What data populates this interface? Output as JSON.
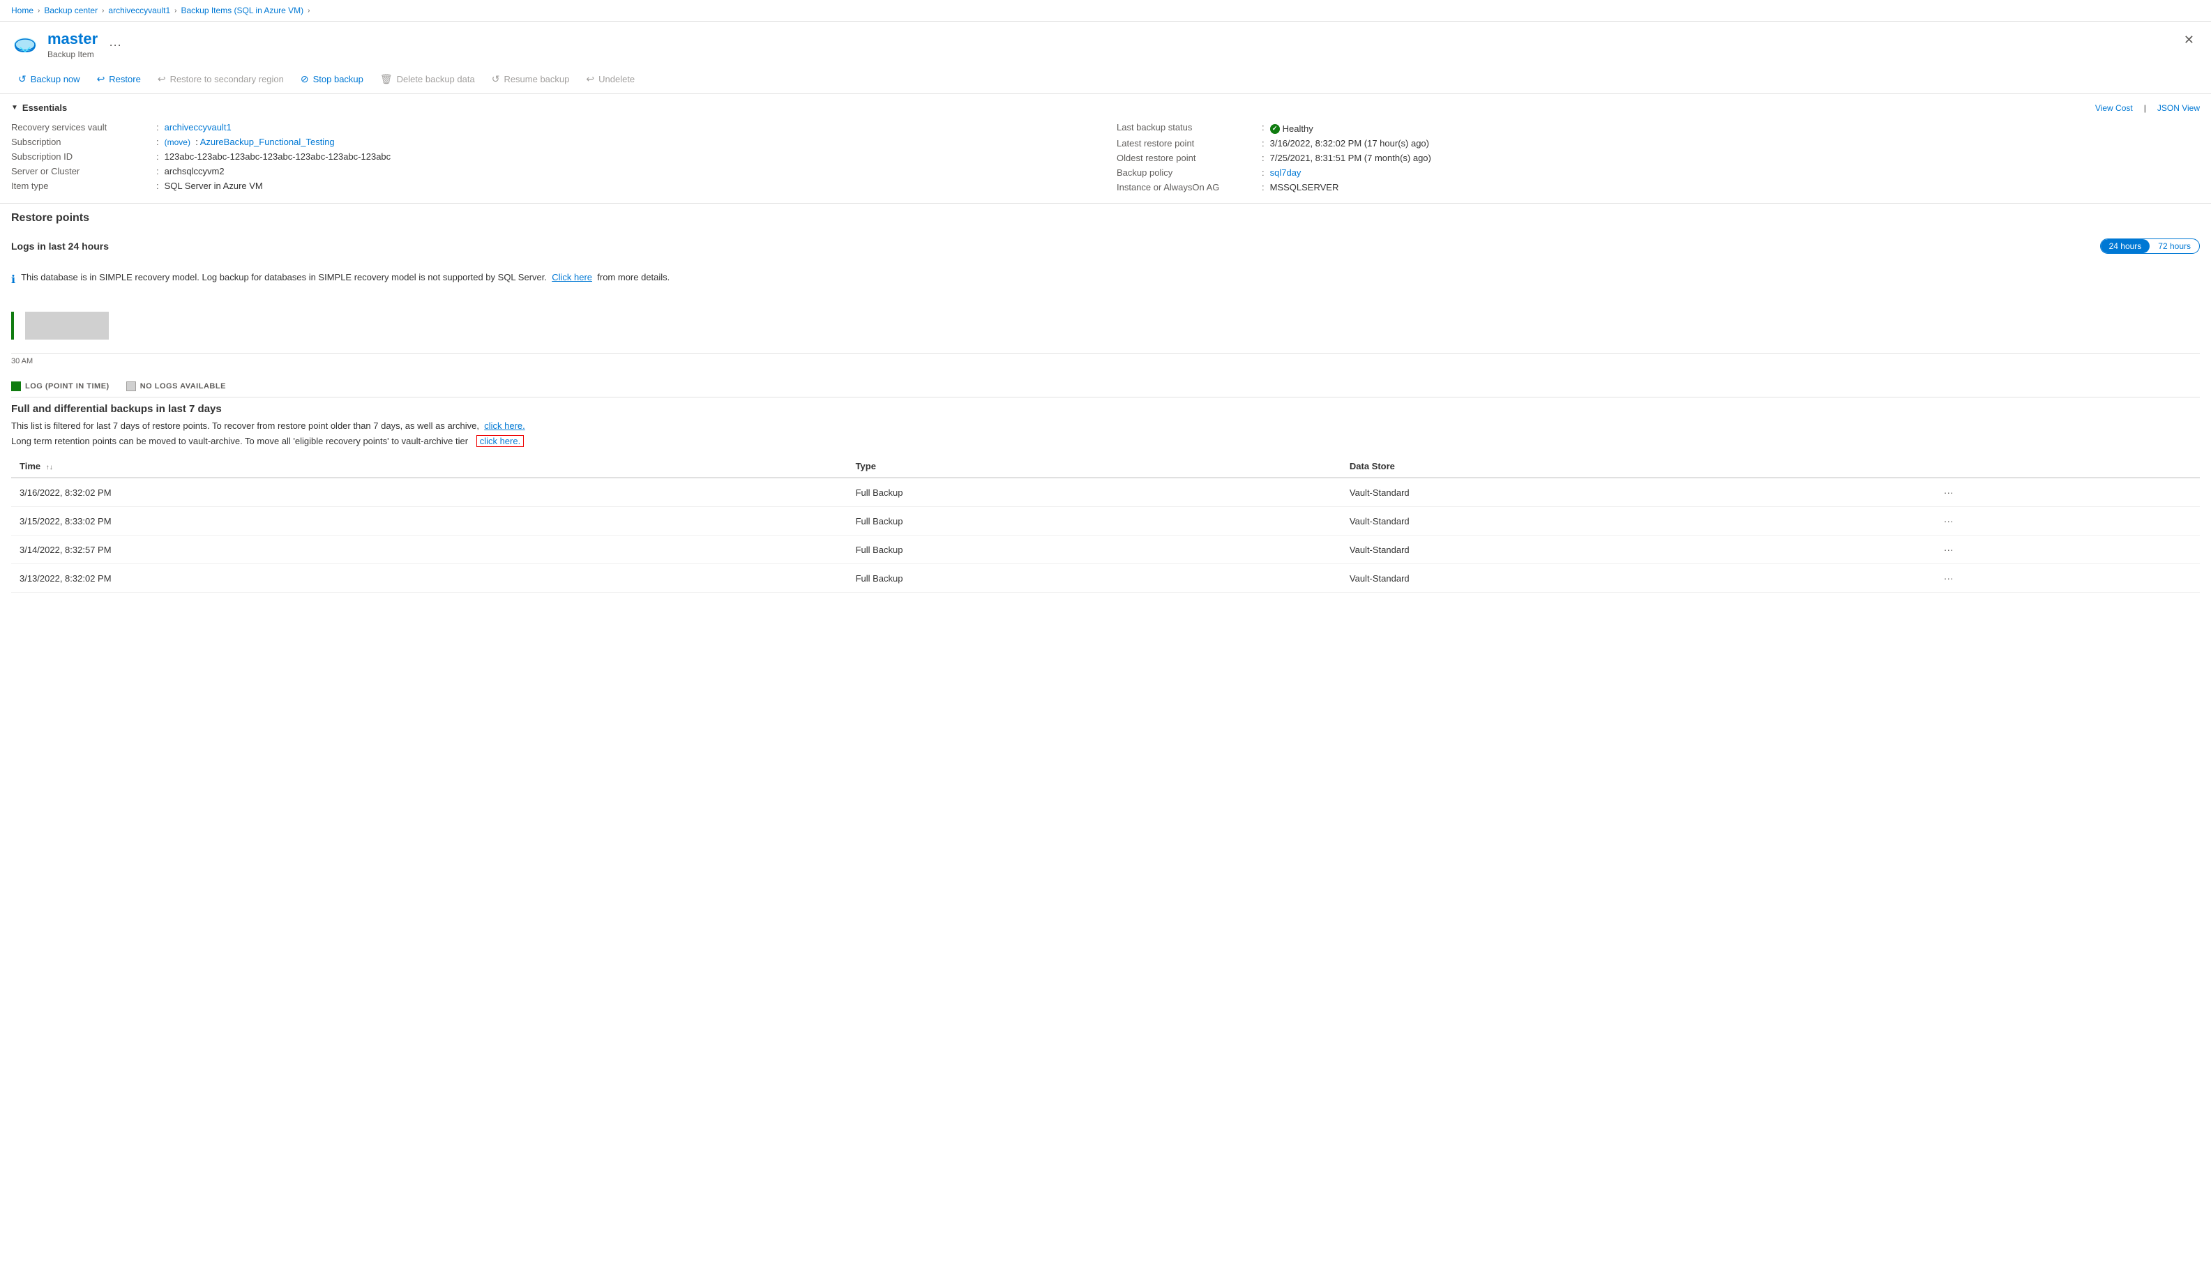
{
  "breadcrumb": {
    "items": [
      "Home",
      "Backup center",
      "archiveccyvault1",
      "Backup Items (SQL in Azure VM)"
    ]
  },
  "header": {
    "title": "master",
    "subtitle": "Backup Item",
    "menu_btn": "···",
    "close_btn": "✕"
  },
  "toolbar": {
    "buttons": [
      {
        "id": "backup-now",
        "label": "Backup now",
        "icon": "↺",
        "disabled": false
      },
      {
        "id": "restore",
        "label": "Restore",
        "icon": "↩",
        "disabled": false
      },
      {
        "id": "restore-secondary",
        "label": "Restore to secondary region",
        "icon": "↩",
        "disabled": true
      },
      {
        "id": "stop-backup",
        "label": "Stop backup",
        "icon": "⊘",
        "disabled": false
      },
      {
        "id": "delete-backup",
        "label": "Delete backup data",
        "icon": "🗑",
        "disabled": true
      },
      {
        "id": "resume-backup",
        "label": "Resume backup",
        "icon": "↺",
        "disabled": true
      },
      {
        "id": "undelete",
        "label": "Undelete",
        "icon": "↩",
        "disabled": true
      }
    ]
  },
  "essentials": {
    "section_title": "Essentials",
    "view_cost": "View Cost",
    "json_view": "JSON View",
    "left_fields": [
      {
        "label": "Recovery services vault",
        "value": "archiveccyvault1",
        "is_link": true,
        "link_text": "archiveccyvault1"
      },
      {
        "label": "Subscription",
        "value": "AzureBackup_Functional_Testing",
        "is_link": true,
        "link_text": "AzureBackup_Functional_Testing",
        "has_move": true,
        "move_text": "(move)"
      },
      {
        "label": "Subscription ID",
        "value": "123abc-123abc-123abc-123abc-123abc-123abc-123abc",
        "is_link": false
      },
      {
        "label": "Server or Cluster",
        "value": "archsqlccyvm2",
        "is_link": false
      },
      {
        "label": "Item type",
        "value": "SQL Server in Azure VM",
        "is_link": false
      }
    ],
    "right_fields": [
      {
        "label": "Last backup status",
        "value": "Healthy",
        "is_status": true
      },
      {
        "label": "Latest restore point",
        "value": "3/16/2022, 8:32:02 PM (17 hour(s) ago)",
        "is_link": false
      },
      {
        "label": "Oldest restore point",
        "value": "7/25/2021, 8:31:51 PM (7 month(s) ago)",
        "is_link": false
      },
      {
        "label": "Backup policy",
        "value": "sql7day",
        "is_link": true,
        "link_text": "sql7day"
      },
      {
        "label": "Instance or AlwaysOn AG",
        "value": "MSSQLSERVER",
        "is_link": false
      }
    ]
  },
  "restore_points": {
    "section_title": "Restore points"
  },
  "logs": {
    "section_title": "Logs in last 24 hours",
    "time_options": [
      "24 hours",
      "72 hours"
    ],
    "active_time": "24 hours",
    "info_message_prefix": "This database is in SIMPLE recovery model. Log backup for databases in SIMPLE recovery model is not supported by SQL Server.",
    "info_click_here": "Click here",
    "info_message_suffix": "from more details.",
    "chart_time_label": "30 AM"
  },
  "legend": {
    "items": [
      {
        "label": "LOG (POINT IN TIME)",
        "color": "green"
      },
      {
        "label": "NO LOGS AVAILABLE",
        "color": "gray"
      }
    ]
  },
  "full_backups": {
    "section_title": "Full and differential backups in last 7 days",
    "filter_text_prefix": "This list is filtered for last 7 days of restore points. To recover from restore point older than 7 days, as well as archive,",
    "filter_link1": "click here.",
    "retention_text_prefix": "Long term retention points can be moved to vault-archive. To move all 'eligible recovery points' to vault-archive tier",
    "retention_link": "click here.",
    "table": {
      "columns": [
        {
          "id": "time",
          "label": "Time",
          "sortable": true
        },
        {
          "id": "type",
          "label": "Type",
          "sortable": false
        },
        {
          "id": "data_store",
          "label": "Data Store",
          "sortable": false
        }
      ],
      "rows": [
        {
          "time": "3/16/2022, 8:32:02 PM",
          "type": "Full Backup",
          "data_store": "Vault-Standard"
        },
        {
          "time": "3/15/2022, 8:33:02 PM",
          "type": "Full Backup",
          "data_store": "Vault-Standard"
        },
        {
          "time": "3/14/2022, 8:32:57 PM",
          "type": "Full Backup",
          "data_store": "Vault-Standard"
        },
        {
          "time": "3/13/2022, 8:32:02 PM",
          "type": "Full Backup",
          "data_store": "Vault-Standard"
        }
      ]
    }
  },
  "colors": {
    "accent": "#0078d4",
    "healthy_green": "#107c10",
    "border": "#e0e0e0",
    "disabled": "#a19f9d"
  }
}
